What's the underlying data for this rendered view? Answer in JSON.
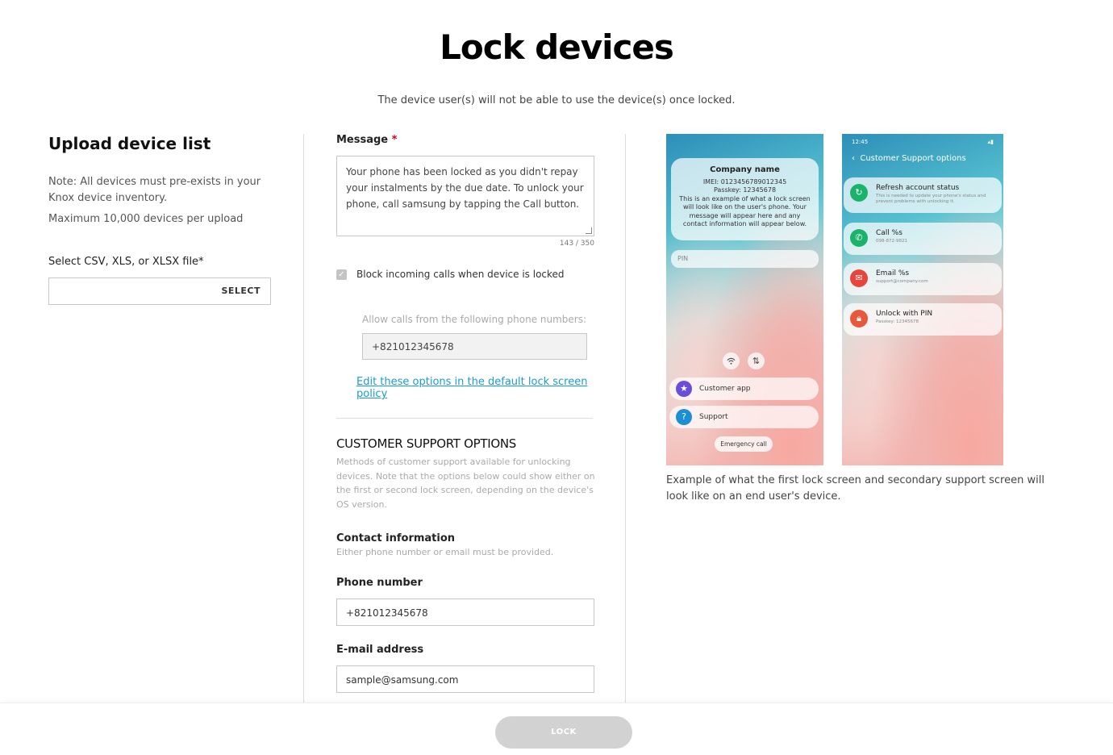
{
  "page": {
    "title": "Lock devices",
    "subtitle": "The device user(s) will not be able to use the device(s) once locked."
  },
  "upload": {
    "heading": "Upload device list",
    "note": "Note: All devices must pre-exists in your Knox device inventory.",
    "max": "Maximum 10,000 devices per upload",
    "file_label": "Select CSV, XLS, or XLSX file*",
    "file_value": "",
    "select_label": "SELECT"
  },
  "message": {
    "label": "Message",
    "required_mark": "*",
    "value": "Your phone has been locked as you didn't repay your instalments by the due date. To unlock your phone, call samsung by tapping the Call button.",
    "count": "143 / 350"
  },
  "block_calls": {
    "label": "Block incoming calls when device is locked",
    "checked": true,
    "allow_label": "Allow calls from the following phone numbers:",
    "allow_value": "+821012345678"
  },
  "edit_link": "Edit these options in the default lock screen policy",
  "support": {
    "title": "CUSTOMER SUPPORT OPTIONS",
    "description": "Methods of customer support available for unlocking devices. Note that the options below could show either on the first or second lock screen, depending on the device's OS version.",
    "contact_label": "Contact information",
    "contact_desc": "Either phone number or email must be provided.",
    "phone_label": "Phone number",
    "phone_value": "+821012345678",
    "email_label": "E-mail address",
    "email_value": "sample@samsung.com"
  },
  "preview": {
    "screen1": {
      "company": "Company name",
      "imei": "IMEI: 0123456789012345",
      "passkey": "Passkey: 12345678",
      "body": "This is an example of what a lock screen will look like on the user's phone. Your message will appear here and any contact information will appear below.",
      "pin": "PIN",
      "customer_app": "Customer app",
      "support": "Support",
      "emergency": "Emergency call"
    },
    "screen2": {
      "time": "12:45",
      "header": "Customer Support options",
      "options": [
        {
          "title": "Refresh account status",
          "sub": "This is needed to update your phone's status and prevent problems with unlocking it.",
          "color": "#1bb36b"
        },
        {
          "title": "Call %s",
          "sub": "098-872-9821",
          "color": "#1bb36b"
        },
        {
          "title": "Email %s",
          "sub": "support@company.com",
          "color": "#e8453c"
        },
        {
          "title": "Unlock with PIN",
          "sub": "Passkey: 12345678",
          "color": "#e8583c"
        }
      ]
    },
    "caption": "Example of what the first lock screen and secondary support screen will look like on an end user's device."
  },
  "footer": {
    "lock_label": "LOCK"
  }
}
